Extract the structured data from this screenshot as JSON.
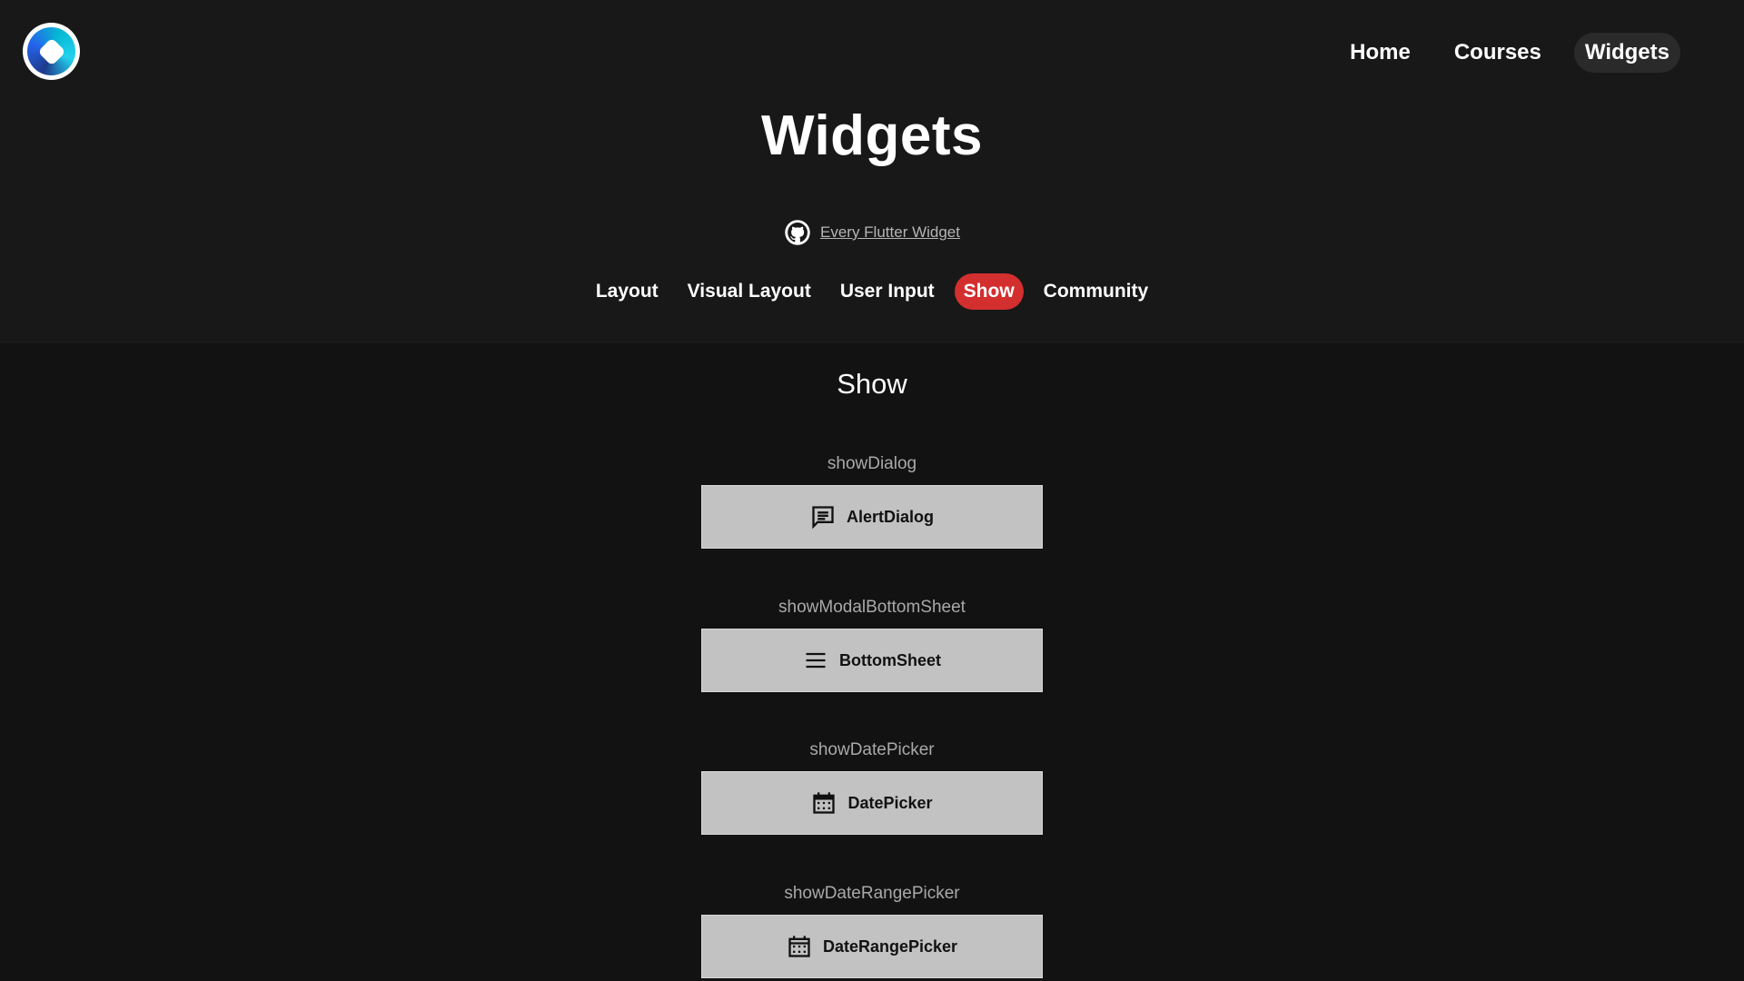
{
  "header": {
    "nav": [
      {
        "label": "Home",
        "active": false
      },
      {
        "label": "Courses",
        "active": false
      },
      {
        "label": "Widgets",
        "active": true
      }
    ]
  },
  "page": {
    "title": "Widgets",
    "github_link": "Every Flutter Widget"
  },
  "categories": [
    {
      "label": "Layout",
      "active": false
    },
    {
      "label": "Visual Layout",
      "active": false
    },
    {
      "label": "User Input",
      "active": false
    },
    {
      "label": "Show",
      "active": true
    },
    {
      "label": "Community",
      "active": false
    }
  ],
  "section": {
    "title": "Show",
    "items": [
      {
        "label": "showDialog",
        "button": "AlertDialog",
        "icon": "message-icon"
      },
      {
        "label": "showModalBottomSheet",
        "button": "BottomSheet",
        "icon": "menu-icon"
      },
      {
        "label": "showDatePicker",
        "button": "DatePicker",
        "icon": "calendar-icon"
      },
      {
        "label": "showDateRangePicker",
        "button": "DateRangePicker",
        "icon": "calendar-icon"
      }
    ]
  },
  "colors": {
    "background": "#121212",
    "header_background": "#181818",
    "accent": "#d32f2f",
    "button": "#c2c2c2"
  }
}
